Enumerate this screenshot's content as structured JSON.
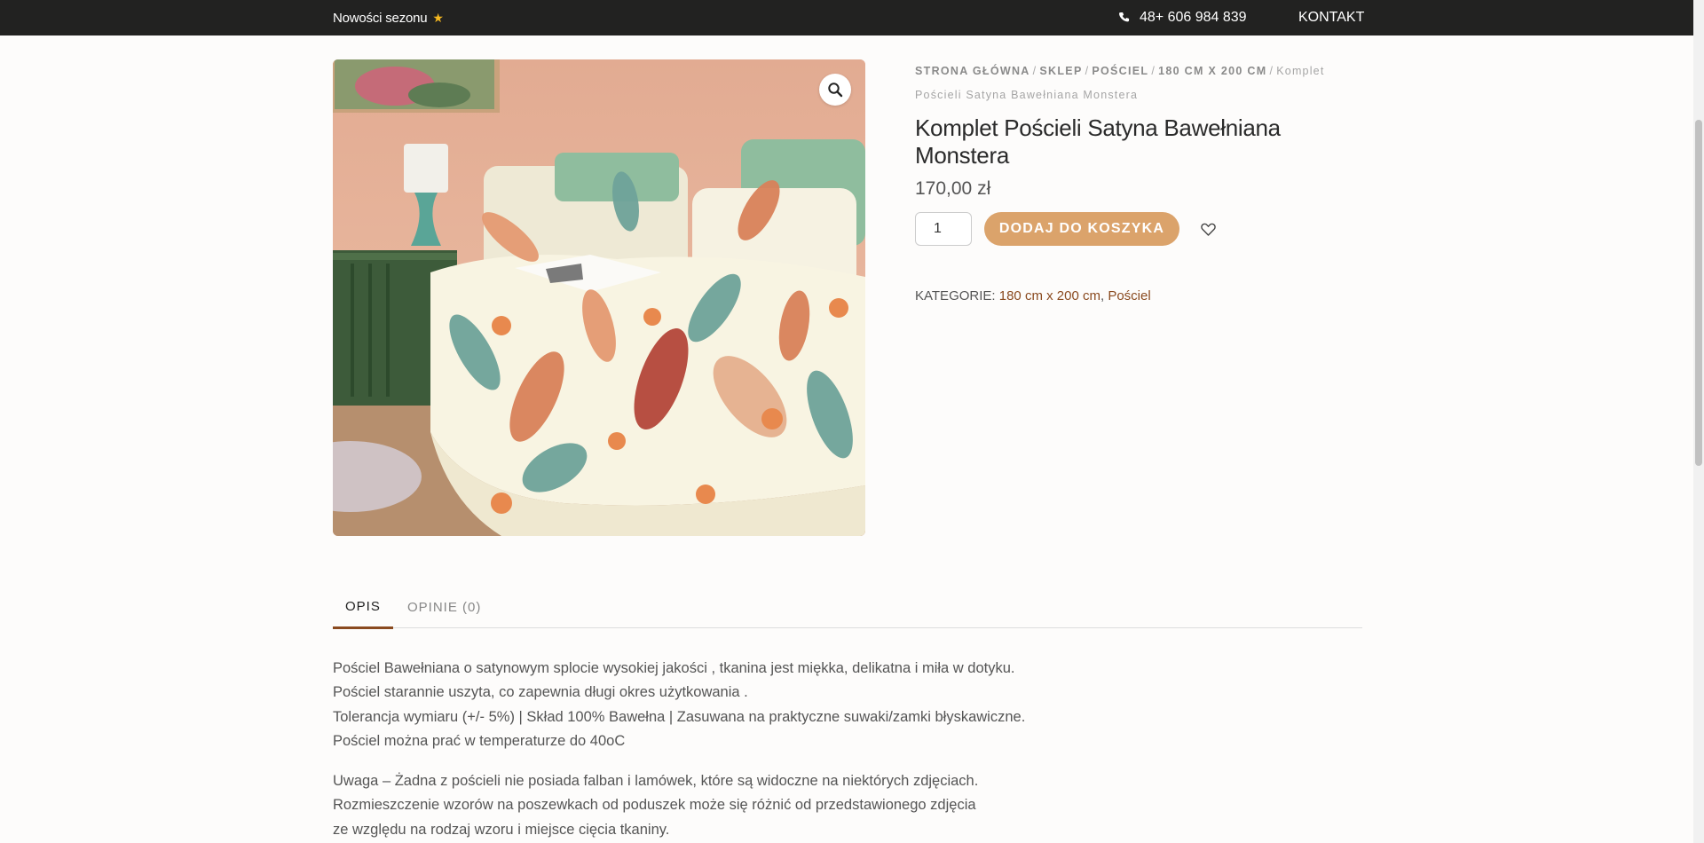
{
  "topbar": {
    "promo": "Nowości sezonu",
    "promo_icon": "star-icon",
    "phone_icon": "phone-icon",
    "phone": "48+ 606 984 839",
    "contact": "KONTAKT"
  },
  "breadcrumb": {
    "items": [
      "Strona główna",
      "Sklep",
      "Pościel",
      "180 cm x 200 cm"
    ],
    "current": "Komplet Pościeli Satyna Bawełniana Monstera",
    "separator": "/"
  },
  "product": {
    "title": "Komplet Pościeli Satyna Bawełniana Monstera",
    "price": "170,00 zł",
    "quantity": "1",
    "add_to_cart": "Dodaj do koszyka",
    "categories_label": "Kategorie:",
    "categories": [
      "180 cm x 200 cm",
      "Pościel"
    ],
    "categories_sep": ", "
  },
  "tabs": [
    {
      "label": "Opis",
      "active": true
    },
    {
      "label": "Opinie (0)",
      "active": false
    }
  ],
  "description": {
    "paragraph1": [
      "Pościel Bawełniana o satynowym splocie wysokiej jakości , tkanina jest miękka, delikatna i miła w dotyku.",
      "Pościel starannie uszyta, co zapewnia długi okres użytkowania .",
      "Tolerancja wymiaru (+/- 5%) | Skład 100% Bawełna | Zasuwana na praktyczne suwaki/zamki błyskawiczne.",
      "Pościel można prać w temperaturze do 40oC"
    ],
    "paragraph2": [
      "Uwaga – Żadna z pościeli nie posiada falban i lamówek, które są widoczne na niektórych zdjęciach.",
      "Rozmieszczenie wzorów na poszewkach od poduszek może się różnić od przedstawionego zdjęcia",
      "ze względu na rodzaj wzoru i miejsce cięcia tkaniny."
    ]
  },
  "colors": {
    "topbar_bg": "#222221",
    "accent": "#dba36b",
    "link": "#8a4a1f",
    "star": "#f5b820"
  },
  "icons": {
    "zoom": "magnifier-icon",
    "wishlist": "heart-icon"
  }
}
